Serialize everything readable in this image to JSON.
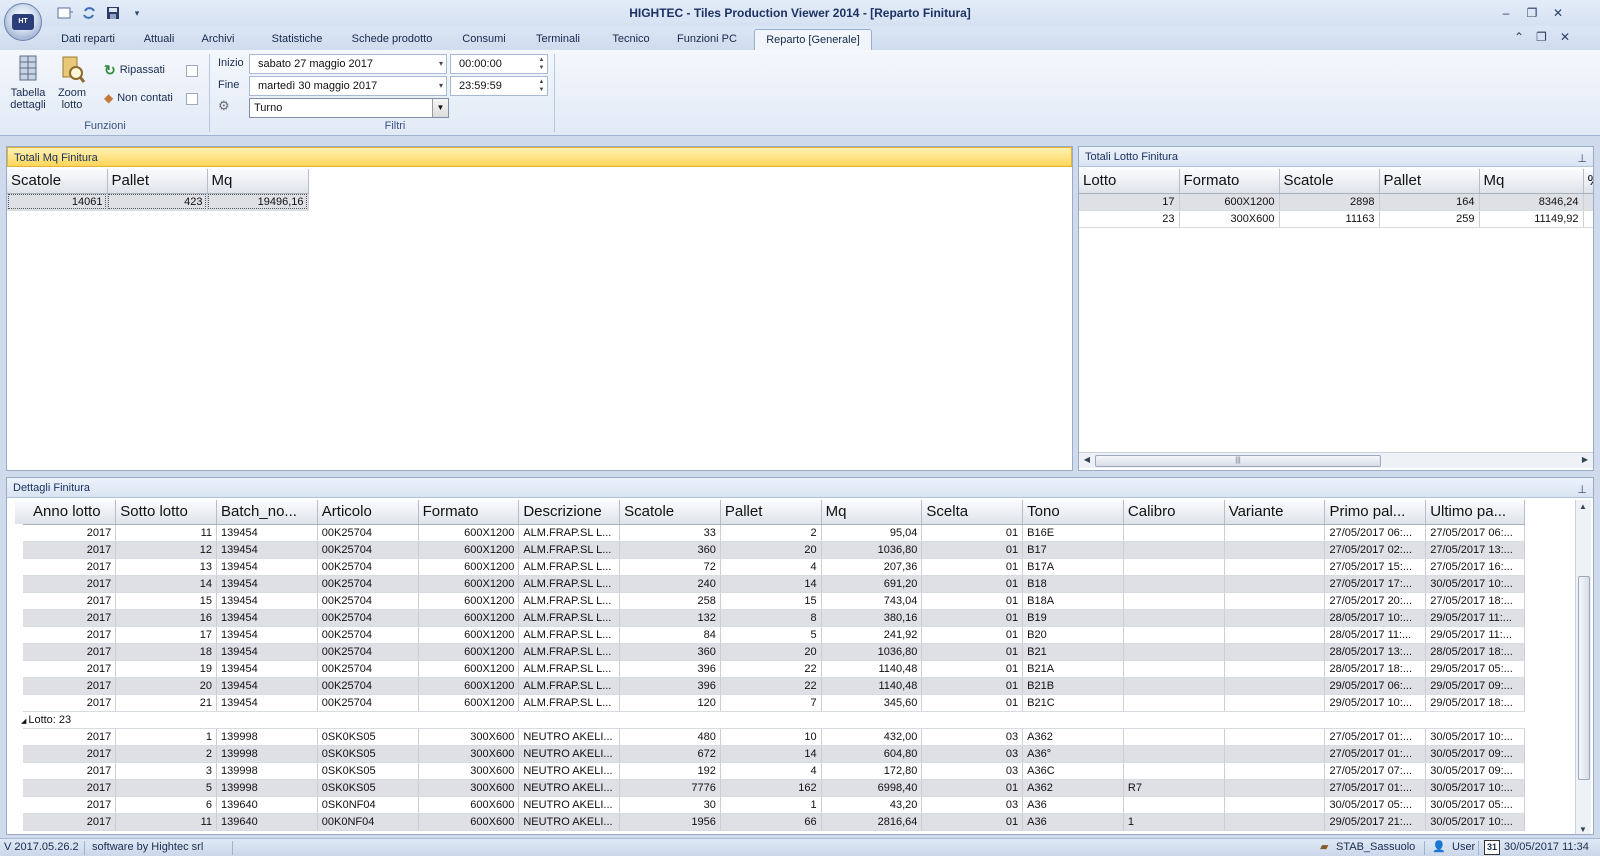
{
  "window": {
    "title": "HIGHTEC - Tiles Production Viewer 2014 - [Reparto Finitura]",
    "qat_icons": [
      "new-document-icon",
      "refresh-icon",
      "save-icon",
      "customize-qat-icon"
    ]
  },
  "tabs": [
    {
      "label": "Dati reparti",
      "active": false
    },
    {
      "label": "Attuali",
      "active": false
    },
    {
      "label": "Archivi",
      "active": false
    },
    {
      "label": "Statistiche",
      "active": false
    },
    {
      "label": "Schede prodotto",
      "active": false
    },
    {
      "label": "Consumi",
      "active": false
    },
    {
      "label": "Terminali",
      "active": false
    },
    {
      "label": "Tecnico",
      "active": false
    },
    {
      "label": "Funzioni PC",
      "active": false
    },
    {
      "label": "Reparto [Generale]",
      "active": true
    }
  ],
  "ribbon": {
    "funzioni": {
      "group_label": "Funzioni",
      "tabella_line1": "Tabella",
      "tabella_line2": "dettagli",
      "zoom_line1": "Zoom",
      "zoom_line2": "lotto",
      "ripassati": "Ripassati",
      "non_contati": "Non contati"
    },
    "filtri": {
      "group_label": "Filtri",
      "inizio_label": "Inizio",
      "inizio_date": "sabato    27    maggio    2017",
      "inizio_time": "00:00:00",
      "fine_label": "Fine",
      "fine_date": "martedì    30    maggio    2017",
      "fine_time": "23:59:59",
      "turno": "Turno"
    }
  },
  "totali_mq": {
    "header": "Totali Mq Finitura",
    "columns": [
      "Scatole",
      "Pallet",
      "Mq"
    ],
    "rows": [
      [
        "14061",
        "423",
        "19496,16"
      ]
    ]
  },
  "totali_lotto": {
    "header": "Totali Lotto Finitura",
    "columns": [
      "Lotto",
      "Formato",
      "Scatole",
      "Pallet",
      "Mq",
      "%"
    ],
    "rows": [
      [
        "17",
        "600X1200",
        "2898",
        "164",
        "8346,24"
      ],
      [
        "23",
        "300X600",
        "11163",
        "259",
        "11149,92"
      ]
    ]
  },
  "dettagli": {
    "header": "Dettagli Finitura",
    "columns": [
      "Anno lotto",
      "Sotto lotto",
      "Batch_no...",
      "Articolo",
      "Formato",
      "Descrizione",
      "Scatole",
      "Pallet",
      "Mq",
      "Scelta",
      "Tono",
      "Calibro",
      "Variante",
      "Primo pal...",
      "Ultimo pa..."
    ],
    "rows_group1": [
      [
        "2017",
        "11",
        "139454",
        "00K25704",
        "600X1200",
        "ALM.FRAP.SL L...",
        "33",
        "2",
        "95,04",
        "01",
        "B16E",
        "",
        "",
        "27/05/2017 06:...",
        "27/05/2017 06:..."
      ],
      [
        "2017",
        "12",
        "139454",
        "00K25704",
        "600X1200",
        "ALM.FRAP.SL L...",
        "360",
        "20",
        "1036,80",
        "01",
        "B17",
        "",
        "",
        "27/05/2017 02:...",
        "27/05/2017 13:..."
      ],
      [
        "2017",
        "13",
        "139454",
        "00K25704",
        "600X1200",
        "ALM.FRAP.SL L...",
        "72",
        "4",
        "207,36",
        "01",
        "B17A",
        "",
        "",
        "27/05/2017 15:...",
        "27/05/2017 16:..."
      ],
      [
        "2017",
        "14",
        "139454",
        "00K25704",
        "600X1200",
        "ALM.FRAP.SL L...",
        "240",
        "14",
        "691,20",
        "01",
        "B18",
        "",
        "",
        "27/05/2017 17:...",
        "30/05/2017 10:..."
      ],
      [
        "2017",
        "15",
        "139454",
        "00K25704",
        "600X1200",
        "ALM.FRAP.SL L...",
        "258",
        "15",
        "743,04",
        "01",
        "B18A",
        "",
        "",
        "27/05/2017 20:...",
        "27/05/2017 18:..."
      ],
      [
        "2017",
        "16",
        "139454",
        "00K25704",
        "600X1200",
        "ALM.FRAP.SL L...",
        "132",
        "8",
        "380,16",
        "01",
        "B19",
        "",
        "",
        "28/05/2017 10:...",
        "29/05/2017 11:..."
      ],
      [
        "2017",
        "17",
        "139454",
        "00K25704",
        "600X1200",
        "ALM.FRAP.SL L...",
        "84",
        "5",
        "241,92",
        "01",
        "B20",
        "",
        "",
        "28/05/2017 11:...",
        "29/05/2017 11:..."
      ],
      [
        "2017",
        "18",
        "139454",
        "00K25704",
        "600X1200",
        "ALM.FRAP.SL L...",
        "360",
        "20",
        "1036,80",
        "01",
        "B21",
        "",
        "",
        "28/05/2017 13:...",
        "28/05/2017 18:..."
      ],
      [
        "2017",
        "19",
        "139454",
        "00K25704",
        "600X1200",
        "ALM.FRAP.SL L...",
        "396",
        "22",
        "1140,48",
        "01",
        "B21A",
        "",
        "",
        "28/05/2017 18:...",
        "29/05/2017 05:..."
      ],
      [
        "2017",
        "20",
        "139454",
        "00K25704",
        "600X1200",
        "ALM.FRAP.SL L...",
        "396",
        "22",
        "1140,48",
        "01",
        "B21B",
        "",
        "",
        "29/05/2017 06:...",
        "29/05/2017 09:..."
      ],
      [
        "2017",
        "21",
        "139454",
        "00K25704",
        "600X1200",
        "ALM.FRAP.SL L...",
        "120",
        "7",
        "345,60",
        "01",
        "B21C",
        "",
        "",
        "29/05/2017 10:...",
        "29/05/2017 18:..."
      ]
    ],
    "group2_label": "Lotto:  23",
    "rows_group2": [
      [
        "2017",
        "1",
        "139998",
        "0SK0KS05",
        "300X600",
        "NEUTRO AKELI...",
        "480",
        "10",
        "432,00",
        "03",
        "A362",
        "",
        "",
        "27/05/2017 01:...",
        "30/05/2017 10:..."
      ],
      [
        "2017",
        "2",
        "139998",
        "0SK0KS05",
        "300X600",
        "NEUTRO AKELI...",
        "672",
        "14",
        "604,80",
        "03",
        "A36°",
        "",
        "",
        "27/05/2017 01:...",
        "30/05/2017 09:..."
      ],
      [
        "2017",
        "3",
        "139998",
        "0SK0KS05",
        "300X600",
        "NEUTRO AKELI...",
        "192",
        "4",
        "172,80",
        "03",
        "A36C",
        "",
        "",
        "27/05/2017 07:...",
        "30/05/2017 09:..."
      ],
      [
        "2017",
        "5",
        "139998",
        "0SK0KS05",
        "300X600",
        "NEUTRO AKELI...",
        "7776",
        "162",
        "6998,40",
        "01",
        "A362",
        "R7",
        "",
        "27/05/2017 01:...",
        "30/05/2017 10:..."
      ],
      [
        "2017",
        "6",
        "139640",
        "0SK0NF04",
        "600X600",
        "NEUTRO AKELI...",
        "30",
        "1",
        "43,20",
        "03",
        "A36",
        "",
        "",
        "30/05/2017 05:...",
        "30/05/2017 05:..."
      ],
      [
        "2017",
        "11",
        "139640",
        "00K0NF04",
        "600X600",
        "NEUTRO AKELI...",
        "1956",
        "66",
        "2816,64",
        "01",
        "A36",
        "1",
        "",
        "29/05/2017 21:...",
        "30/05/2017 10:..."
      ]
    ]
  },
  "status": {
    "version": "V 2017.05.26.2",
    "vendor": "software by Hightec srl",
    "station": "STAB_Sassuolo",
    "user": "User",
    "calendar_day": "31",
    "datetime": "30/05/2017 11:34"
  },
  "colors": {
    "highlight_header": "#ffd55a",
    "alt_row": "#dfdfe6",
    "ribbon_bg": "#e2eaf6"
  }
}
